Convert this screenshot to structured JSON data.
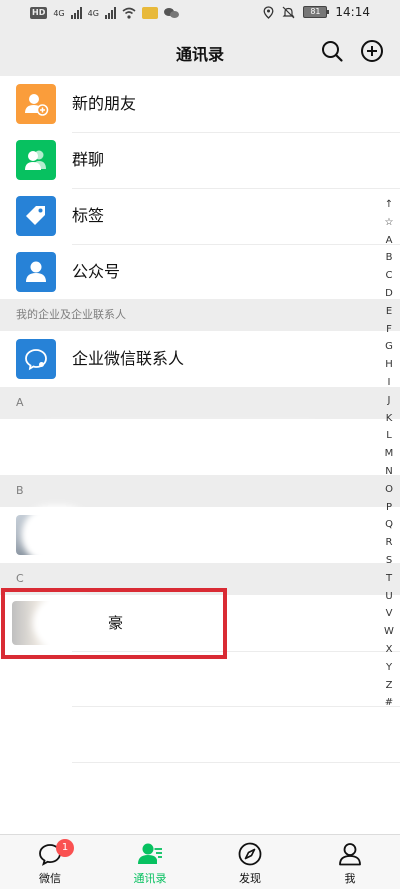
{
  "status_bar": {
    "left_badges": [
      "HD",
      "4G",
      "4G"
    ],
    "battery": "81",
    "time": "14:14"
  },
  "header": {
    "title": "通讯录"
  },
  "menu": {
    "items": [
      {
        "label": "新的朋友",
        "icon": "add-friend-icon",
        "color": "#fa9d3b"
      },
      {
        "label": "群聊",
        "icon": "group-chat-icon",
        "color": "#07c160"
      },
      {
        "label": "标签",
        "icon": "tag-icon",
        "color": "#2782d7"
      },
      {
        "label": "公众号",
        "icon": "official-account-icon",
        "color": "#2782d7"
      }
    ]
  },
  "enterprise_section": {
    "header": "我的企业及企业联系人",
    "item_label": "企业微信联系人",
    "icon": "enterprise-wechat-icon",
    "color": "#2782d7"
  },
  "contacts": {
    "sections": [
      {
        "letter": "A"
      },
      {
        "letter": "B"
      },
      {
        "letter": "C",
        "visible_name": "豪"
      }
    ]
  },
  "index_bar": [
    "↑",
    "☆",
    "A",
    "B",
    "C",
    "D",
    "E",
    "F",
    "G",
    "H",
    "I",
    "J",
    "K",
    "L",
    "M",
    "N",
    "O",
    "P",
    "Q",
    "R",
    "S",
    "T",
    "U",
    "V",
    "W",
    "X",
    "Y",
    "Z",
    "#"
  ],
  "tabs": [
    {
      "label": "微信",
      "icon": "chat-icon",
      "badge": "1"
    },
    {
      "label": "通讯录",
      "icon": "contacts-icon",
      "active": true
    },
    {
      "label": "发现",
      "icon": "compass-icon"
    },
    {
      "label": "我",
      "icon": "me-icon"
    }
  ],
  "colors": {
    "accent": "#07c160",
    "highlight": "#d92b34",
    "badge": "#fa5151"
  }
}
